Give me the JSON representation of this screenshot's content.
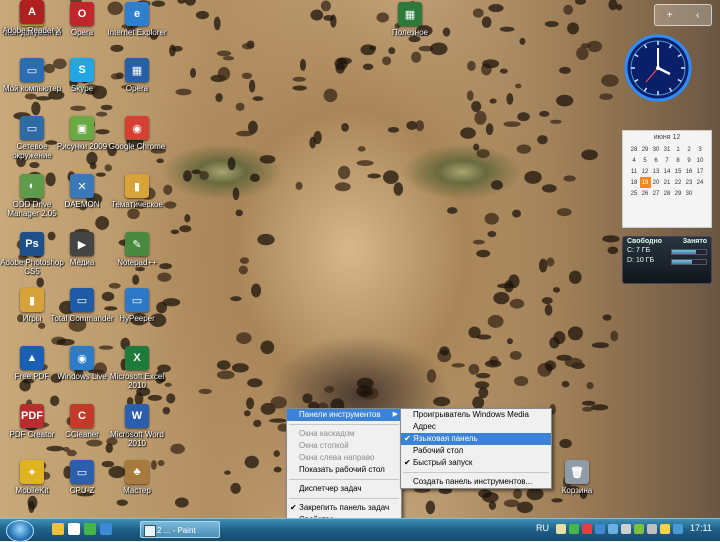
{
  "desktop_icons": [
    {
      "id": "my-documents",
      "label": "Мои документы",
      "color": "#e8c04a",
      "glyph": "▤"
    },
    {
      "id": "opera",
      "label": "Opera",
      "color": "#c0262b",
      "glyph": "O"
    },
    {
      "id": "internet-explorer",
      "label": "Internet Explorer",
      "color": "#2f7fd1",
      "glyph": "e"
    },
    {
      "id": "my-computer",
      "label": "Мой компьютер",
      "color": "#2a6db3",
      "glyph": "▭"
    },
    {
      "id": "skype",
      "label": "Skype",
      "color": "#22a7e4",
      "glyph": "S"
    },
    {
      "id": "opera-2",
      "label": "Opera",
      "color": "#2560a8",
      "glyph": "▦"
    },
    {
      "id": "network",
      "label": "Сетевое окружение",
      "color": "#2d6aa6",
      "glyph": "▭"
    },
    {
      "id": "pictures",
      "label": "Рисунки 2009",
      "color": "#6ba943",
      "glyph": "▣"
    },
    {
      "id": "google-chrome",
      "label": "Google Chrome",
      "color": "#d64032",
      "glyph": "◉"
    },
    {
      "id": "drive-manager",
      "label": "ODD Drive Manager 2.05",
      "color": "#5e9b4a",
      "glyph": "◐"
    },
    {
      "id": "daemon",
      "label": "DAEMON",
      "color": "#3a78b8",
      "glyph": "✕"
    },
    {
      "id": "folder-1",
      "label": "Тематическое",
      "color": "#d8a23a",
      "glyph": "▮"
    },
    {
      "id": "photoshop",
      "label": "Adobe Photoshop CS5",
      "color": "#1d4f8a",
      "glyph": "Ps"
    },
    {
      "id": "media",
      "label": "Медиа",
      "color": "#444444",
      "glyph": "▶"
    },
    {
      "id": "notepad",
      "label": "Notepad++",
      "color": "#4a8a40",
      "glyph": "✎"
    },
    {
      "id": "folder-2",
      "label": "Игры",
      "color": "#d8a23a",
      "glyph": "▮"
    },
    {
      "id": "total-commander",
      "label": "Total Commander",
      "color": "#1f5aa6",
      "glyph": "▭"
    },
    {
      "id": "hyper",
      "label": "HyPeeper",
      "color": "#2e79c6",
      "glyph": "▭"
    },
    {
      "id": "free-pdf",
      "label": "Free PDF",
      "color": "#1a5fb4",
      "glyph": "▲"
    },
    {
      "id": "windows-live",
      "label": "Windows Live",
      "color": "#2c7cc8",
      "glyph": "◉"
    },
    {
      "id": "excel",
      "label": "Microsoft Excel 2010",
      "color": "#1e7b3c",
      "glyph": "X"
    },
    {
      "id": "pdf-creator",
      "label": "PDF Creator",
      "color": "#b82e2e",
      "glyph": "PDF"
    },
    {
      "id": "ccleaner",
      "label": "CCleaner",
      "color": "#c43a2a",
      "glyph": "C"
    },
    {
      "id": "word",
      "label": "Microsoft Word 2010",
      "color": "#2b5fae",
      "glyph": "W"
    },
    {
      "id": "mobilekit",
      "label": "MobileKit",
      "color": "#e0b420",
      "glyph": "✦"
    },
    {
      "id": "cpu-z",
      "label": "CPU-Z",
      "color": "#2b5fae",
      "glyph": "▭"
    },
    {
      "id": "all-in-one",
      "label": "Мастер",
      "color": "#a87a3e",
      "glyph": "♣"
    },
    {
      "id": "adobe-reader",
      "label": "Adobe Reader X",
      "color": "#b02020",
      "glyph": "A"
    },
    {
      "id": "recycle-bin",
      "label": "Корзина",
      "color": "#8e9ca8",
      "glyph": "🗑"
    },
    {
      "id": "tvplayer",
      "label": "Полезное",
      "color": "#2e7a3a",
      "glyph": "▦"
    }
  ],
  "gadgets": {
    "controls": {
      "add": "+",
      "more": "‹"
    },
    "calendar": {
      "month": "июня 12",
      "rows": [
        [
          "28",
          "29",
          "30",
          "31",
          "1",
          "2",
          "3"
        ],
        [
          "4",
          "5",
          "6",
          "7",
          "8",
          "9",
          "10"
        ],
        [
          "11",
          "12",
          "13",
          "14",
          "15",
          "16",
          "17"
        ],
        [
          "18",
          "19",
          "20",
          "21",
          "22",
          "23",
          "24"
        ],
        [
          "25",
          "26",
          "27",
          "28",
          "29",
          "30",
          ""
        ],
        [
          "",
          "",
          "",
          "",
          "",
          "",
          ""
        ]
      ],
      "today": "19"
    },
    "drive_meter": {
      "free_label": "Свободно",
      "used_label": "Занято",
      "rows": [
        {
          "drive": "C:",
          "free": "7 ГБ",
          "used_fraction": 0.7
        },
        {
          "drive": "D:",
          "free": "10 ГБ",
          "used_fraction": 0.6
        }
      ]
    }
  },
  "context_menu": {
    "items": [
      {
        "label": "Панели инструментов",
        "state": "highlight",
        "submenu": true
      },
      {
        "sep": true
      },
      {
        "label": "Окна каскадом",
        "state": "disabled"
      },
      {
        "label": "Окна стопкой",
        "state": "disabled"
      },
      {
        "label": "Окна слева направо",
        "state": "disabled"
      },
      {
        "label": "Показать рабочий стол",
        "state": "normal"
      },
      {
        "sep": true
      },
      {
        "label": "Диспетчер задач",
        "state": "normal"
      },
      {
        "sep": true
      },
      {
        "label": "Закрепить панель задач",
        "state": "normal",
        "checked": true
      },
      {
        "label": "Свойства",
        "state": "normal"
      }
    ]
  },
  "toolbars_submenu": {
    "items": [
      {
        "label": "Проигрыватель Windows Media",
        "state": "normal"
      },
      {
        "label": "Адрес",
        "state": "normal"
      },
      {
        "label": "Языковая панель",
        "state": "highlight",
        "checked": true
      },
      {
        "label": "Рабочий стол",
        "state": "normal"
      },
      {
        "label": "Быстрый запуск",
        "state": "normal",
        "checked": true
      },
      {
        "sep": true
      },
      {
        "label": "Создать панель инструментов...",
        "state": "normal"
      }
    ]
  },
  "taskbar": {
    "task_label": "2 ... - Paint",
    "language": "RU",
    "clock": "17:11",
    "tray_colors": [
      "#e8e0a0",
      "#49b64a",
      "#e04040",
      "#3f8ad0",
      "#6ab0e0",
      "#d0d0d0",
      "#7fbf3f",
      "#c0c0c0",
      "#ffd24a",
      "#4a9ad8"
    ],
    "quick_launch_colors": [
      "#f0c040",
      "#ffffff",
      "#43b64a",
      "#3a8ad6"
    ]
  }
}
